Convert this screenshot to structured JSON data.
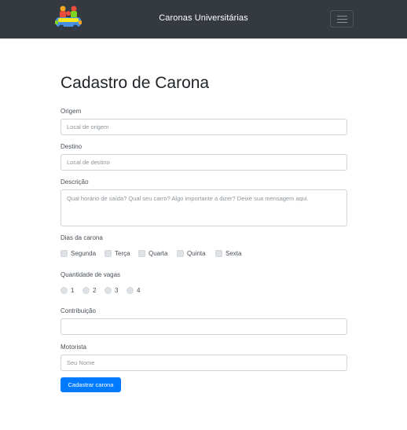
{
  "navbar": {
    "brand": "Caronas Universitárias",
    "logo_icon": "carpool-logo-icon",
    "menu_icon": "hamburger-menu-icon",
    "background_color": "#343a40"
  },
  "form": {
    "title": "Cadastro de Carona",
    "origem": {
      "label": "Origem",
      "placeholder": "Local de origem",
      "value": ""
    },
    "destino": {
      "label": "Destino",
      "placeholder": "Local de destino",
      "value": ""
    },
    "descricao": {
      "label": "Descrição",
      "placeholder": "Qual horário de saída? Qual seu carro? Algo importante a dizer? Deixe sua mensagem aqui.",
      "value": ""
    },
    "dias": {
      "label": "Dias da carona",
      "options": [
        "Segunda",
        "Terça",
        "Quarta",
        "Quinta",
        "Sexta"
      ]
    },
    "vagas": {
      "label": "Quantidade de vagas",
      "options": [
        "1",
        "2",
        "3",
        "4"
      ]
    },
    "contribuicao": {
      "label": "Contribuição",
      "placeholder": "",
      "value": ""
    },
    "motorista": {
      "label": "Motorista",
      "placeholder": "Seu Nome",
      "value": ""
    },
    "submit_label": "Cadastrar carona",
    "accent_color": "#007bff"
  }
}
